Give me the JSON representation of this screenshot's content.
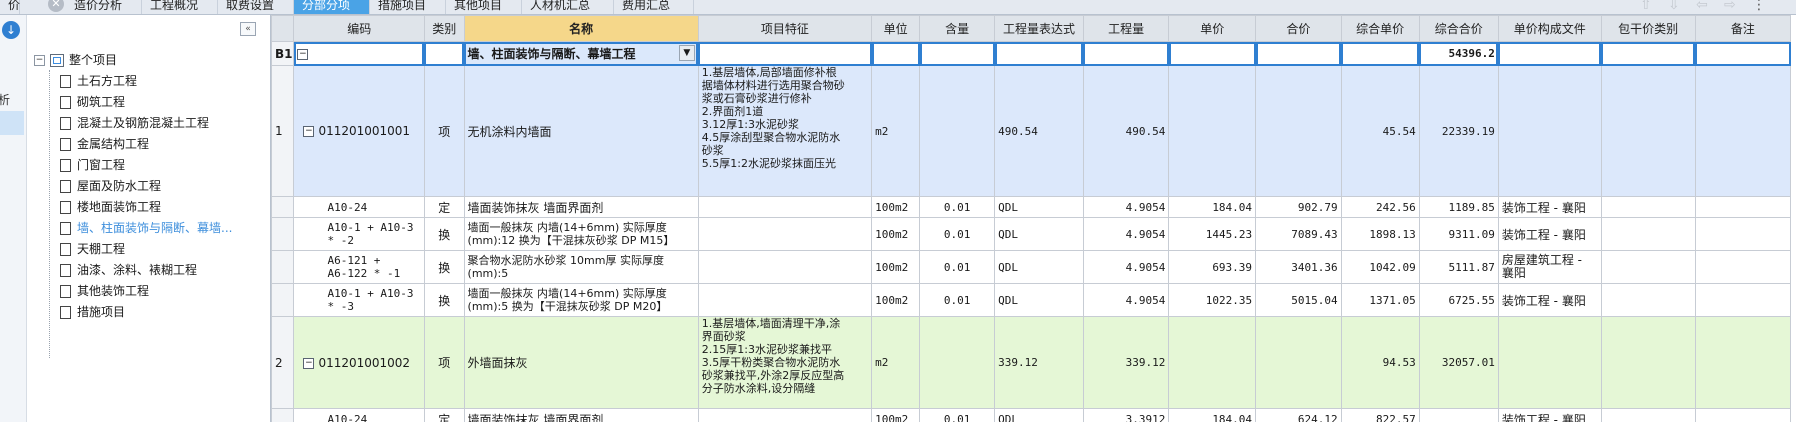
{
  "tabs": [
    "造价分析",
    "工程概况",
    "取费设置",
    "分部分项",
    "措施项目",
    "其他项目",
    "人材机汇总",
    "费用汇总"
  ],
  "active_tab_index": 3,
  "sidebar": {
    "rail_text": "析",
    "collapse_glyph": "«",
    "root_label": "整个项目",
    "items": [
      {
        "label": "土石方工程"
      },
      {
        "label": "砌筑工程"
      },
      {
        "label": "混凝土及钢筋混凝土工程"
      },
      {
        "label": "金属结构工程"
      },
      {
        "label": "门窗工程"
      },
      {
        "label": "屋面及防水工程"
      },
      {
        "label": "楼地面装饰工程"
      },
      {
        "label": "墙、柱面装饰与隔断、幕墙..."
      },
      {
        "label": "天棚工程"
      },
      {
        "label": "油漆、涂料、裱糊工程"
      },
      {
        "label": "其他装饰工程"
      },
      {
        "label": "措施项目"
      }
    ],
    "selected_index": 7
  },
  "grid": {
    "headers": [
      "",
      "编码",
      "类别",
      "名称",
      "项目特征",
      "单位",
      "含量",
      "工程量表达式",
      "工程量",
      "单价",
      "合价",
      "综合单价",
      "综合合价",
      "单价构成文件",
      "包干价类别",
      "备注"
    ],
    "section": {
      "rowno": "B1",
      "name": "墙、柱面装饰与隔断、幕墙工程",
      "total": "54396.2"
    },
    "item1": {
      "rowno": "1",
      "code": "011201001001",
      "type": "项",
      "name": "无机涂料内墙面",
      "feature": "1.基层墙体,局部墙面修补根\n据墙体材料进行选用聚合物砂\n浆或石膏砂浆进行修补\n2.界面剂1道\n3.12厚1:3水泥砂浆\n4.5厚涂刮型聚合物水泥防水\n砂浆\n5.5厚1:2水泥砂浆抹面压光",
      "unit": "m2",
      "expr": "490.54",
      "qty": "490.54",
      "unit_total": "45.54",
      "total": "22339.19"
    },
    "sub1": [
      {
        "code": "A10-24",
        "type": "定",
        "name": "墙面装饰抹灰 墙面界面剂",
        "unit": "100m2",
        "content": "0.01",
        "expr": "QDL",
        "qty": "4.9054",
        "price": "184.04",
        "sum": "902.79",
        "unit_total": "242.56",
        "total": "1189.85",
        "file": "装饰工程 - 襄阳"
      },
      {
        "code": "A10-1 + A10-3\n* -2",
        "type": "换",
        "name": "墙面一般抹灰 内墙(14+6mm)  实际厚度\n(mm):12  换为【干混抹灰砂浆 DP M15】",
        "unit": "100m2",
        "content": "0.01",
        "expr": "QDL",
        "qty": "4.9054",
        "price": "1445.23",
        "sum": "7089.43",
        "unit_total": "1898.13",
        "total": "9311.09",
        "file": "装饰工程 - 襄阳"
      },
      {
        "code": "A6-121 +\nA6-122 * -1",
        "type": "换",
        "name": "聚合物水泥防水砂浆 10mm厚  实际厚度\n(mm):5",
        "unit": "100m2",
        "content": "0.01",
        "expr": "QDL",
        "qty": "4.9054",
        "price": "693.39",
        "sum": "3401.36",
        "unit_total": "1042.09",
        "total": "5111.87",
        "file": "房屋建筑工程 -\n襄阳"
      },
      {
        "code": "A10-1 + A10-3\n* -3",
        "type": "换",
        "name": "墙面一般抹灰 内墙(14+6mm)  实际厚度\n(mm):5  换为【干混抹灰砂浆 DP M20】",
        "unit": "100m2",
        "content": "0.01",
        "expr": "QDL",
        "qty": "4.9054",
        "price": "1022.35",
        "sum": "5015.04",
        "unit_total": "1371.05",
        "total": "6725.55",
        "file": "装饰工程 - 襄阳"
      }
    ],
    "item2": {
      "rowno": "2",
      "code": "011201001002",
      "type": "项",
      "name": "外墙面抹灰",
      "feature": "1.基层墙体,墙面清理干净,涂\n界面砂浆\n2.15厚1:3水泥砂浆兼找平\n3.5厚干粉类聚合物水泥防水\n砂浆兼找平,外涂2厚反应型高\n分子防水涂料,设分隔缝",
      "unit": "m2",
      "expr": "339.12",
      "qty": "339.12",
      "unit_total": "94.53",
      "total": "32057.01"
    },
    "sub2": [
      {
        "code": "A10-24",
        "type": "定",
        "name": "墙面装饰抹灰 墙面界面剂",
        "unit": "100m2",
        "content": "0.01",
        "expr": "QDL",
        "qty": "3.3912",
        "price": "184.04",
        "sum": "624.12",
        "unit_total": "822.57",
        "total": "",
        "file": "装饰工程 - 襄阳"
      }
    ]
  },
  "colors": {
    "accent": "#4aa3e6",
    "selection": "#2f7fd1",
    "header_highlight": "#f5d78a",
    "row_blue": "#dce8fb",
    "row_green": "#e5f7d6"
  }
}
